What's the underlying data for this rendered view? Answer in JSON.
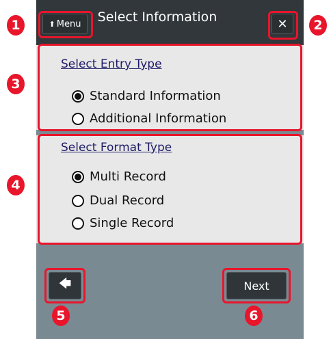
{
  "window": {
    "title": "Select Information",
    "menu_label": "Menu",
    "menu_icon": "up-arrow-icon",
    "close_icon": "close-icon"
  },
  "entry_type": {
    "heading": "Select Entry Type",
    "options": [
      {
        "label": "Standard Information",
        "selected": true
      },
      {
        "label": "Additional Information",
        "selected": false
      }
    ]
  },
  "format_type": {
    "heading": "Select Format Type",
    "options": [
      {
        "label": "Multi Record",
        "selected": true
      },
      {
        "label": "Dual Record",
        "selected": false
      },
      {
        "label": "Single Record",
        "selected": false
      }
    ]
  },
  "footer": {
    "back_icon": "left-arrow-icon",
    "next_label": "Next"
  },
  "callouts": [
    "1",
    "2",
    "3",
    "4",
    "5",
    "6"
  ],
  "colors": {
    "highlight": "#e8152b",
    "titlebar": "#31373a",
    "panel": "#e8e8e8",
    "screen": "#7a8a93",
    "heading_text": "#1d1b66"
  }
}
